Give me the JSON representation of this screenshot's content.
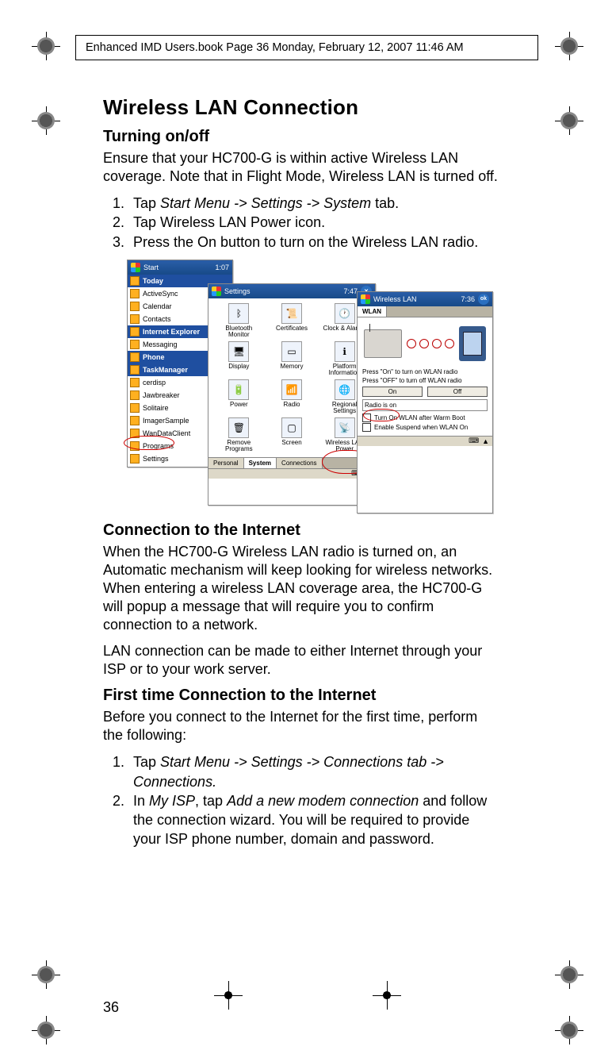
{
  "header": {
    "crop_text": "Enhanced IMD Users.book  Page 36  Monday, February 12, 2007  11:46 AM"
  },
  "page": {
    "number": "36",
    "title": "Wireless LAN Connection",
    "section1": {
      "heading": "Turning on/off",
      "intro": "Ensure that your HC700-G is within active Wireless LAN coverage. Note that in Flight Mode, Wireless LAN is turned off.",
      "steps": [
        {
          "pre": "Tap ",
          "em": "Start Menu -> Settings -> System",
          "post": " tab."
        },
        {
          "pre": "Tap Wireless LAN Power icon.",
          "em": "",
          "post": ""
        },
        {
          "pre": "Press the On button to turn on the Wireless LAN radio.",
          "em": "",
          "post": ""
        }
      ]
    },
    "section2": {
      "heading": "Connection to the Internet",
      "p1": "When the HC700-G Wireless LAN radio is turned on, an Automatic mechanism will keep looking for wireless networks. When entering a wireless LAN coverage area, the HC700-G will popup a message that will require you to confirm connection to a network.",
      "p2": "LAN connection can be made to either Internet through your ISP or to your work server."
    },
    "section3": {
      "heading": "First time Connection to the Internet",
      "intro": "Before you connect to the Internet for the first time, perform the following:",
      "steps": [
        {
          "pre": "Tap ",
          "em": "Start Menu -> Settings -> Connections tab -> Connections.",
          "post": ""
        },
        {
          "pre": "In ",
          "em": "My ISP",
          "mid": ", tap ",
          "em2": "Add a new modem connection",
          "post": " and follow the connection wizard. You will be required to provide your ISP phone number, domain and password."
        }
      ]
    }
  },
  "fig": {
    "pda1": {
      "title": "Start",
      "time": "1:07",
      "menu": [
        "Today",
        "ActiveSync",
        "Calendar",
        "Contacts",
        "Internet Explorer",
        "Messaging",
        "Phone",
        "TaskManager",
        "cerdisp",
        "Jawbreaker",
        "Solitaire",
        "ImagerSample",
        "WanDataClient",
        "Programs",
        "Settings"
      ]
    },
    "pda2": {
      "title": "Settings",
      "time": "7:47",
      "icons": [
        "Bluetooth Monitor",
        "Certificates",
        "Clock & Alarms",
        "Display",
        "Memory",
        "Platform Information",
        "Power",
        "Radio",
        "Regional Settings",
        "Remove Programs",
        "Screen",
        "Wireless LAN Power"
      ],
      "tabs": [
        "Personal",
        "System",
        "Connections"
      ]
    },
    "pda3": {
      "title": "Wireless LAN",
      "time": "7:36",
      "tab": "WLAN",
      "msg1": "Press \"On\" to turn on WLAN radio",
      "msg2": "Press \"OFF\" to turn off WLAN radio",
      "on": "On",
      "off": "Off",
      "status": "Radio is on",
      "cb1": "Turn On WLAN after Warm Boot",
      "cb2": "Enable Suspend when WLAN On"
    }
  }
}
